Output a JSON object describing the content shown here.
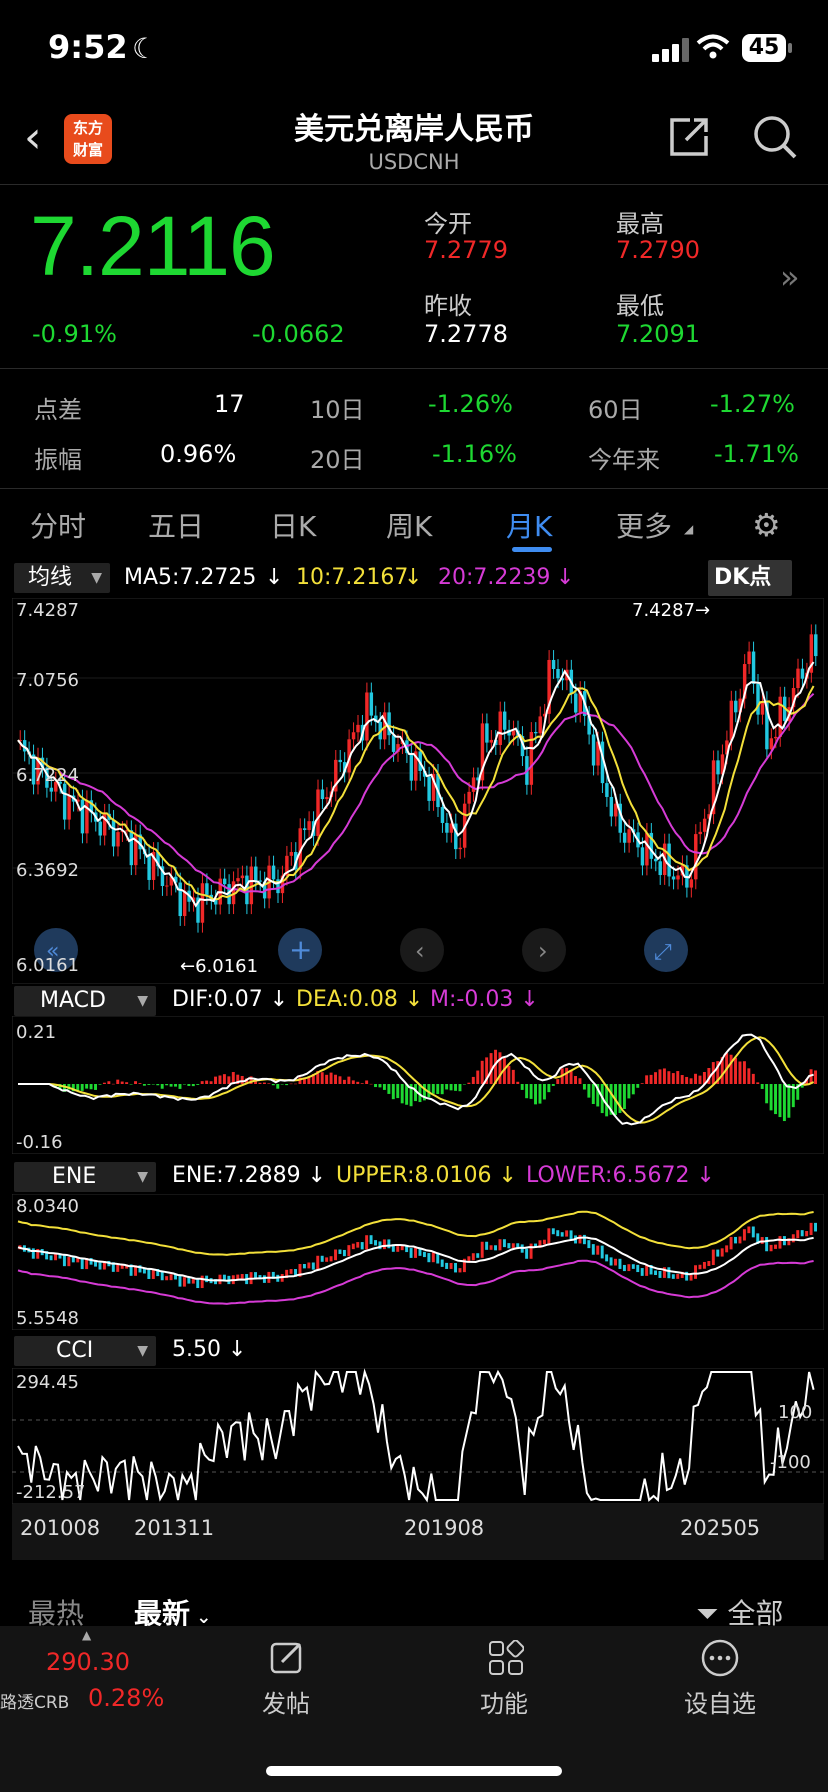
{
  "status_bar": {
    "time": "9:52",
    "battery": "45"
  },
  "header": {
    "logo_line1": "东方",
    "logo_line2": "财富",
    "title": "美元兑离岸人民币",
    "subtitle": "USDCNH"
  },
  "quote": {
    "price": "7.2116",
    "change_pct": "-0.91%",
    "change": "-0.0662",
    "open_label": "今开",
    "open": "7.2779",
    "high_label": "最高",
    "high": "7.2790",
    "prev_label": "昨收",
    "prev": "7.2778",
    "low_label": "最低",
    "low": "7.2091"
  },
  "stats": [
    {
      "label": "点差",
      "value": "17",
      "label2": "10日",
      "value2": "-1.26%",
      "label3": "60日",
      "value3": "-1.27%"
    },
    {
      "label": "振幅",
      "value": "0.96%",
      "label2": "20日",
      "value2": "-1.16%",
      "label3": "今年来",
      "value3": "-1.71%"
    }
  ],
  "tabs": [
    "分时",
    "五日",
    "日K",
    "周K",
    "月K",
    "更多"
  ],
  "active_tab": "月K",
  "chart": {
    "ma_selector": "均线",
    "ma5": "MA5:7.2725",
    "ma10": "10:7.2167",
    "ma20": "20:7.2239",
    "dk_button": "DK点",
    "y_labels": [
      "7.4287",
      "7.0756",
      "6.7224",
      "6.3692",
      "6.0161"
    ],
    "max_marker": "7.4287",
    "min_marker": "6.0161",
    "macd_selector": "MACD",
    "dif": "DIF:0.07",
    "dea": "DEA:0.08",
    "m": "M:-0.03",
    "macd_y": [
      "0.21",
      "-0.16"
    ],
    "ene_selector": "ENE",
    "ene": "ENE:7.2889",
    "upper": "UPPER:8.0106",
    "lower": "LOWER:6.5672",
    "ene_y": [
      "8.0340",
      "5.5548"
    ],
    "cci_selector": "CCI",
    "cci": "5.50",
    "cci_y": [
      "294.45",
      "-212.57"
    ],
    "cci_ref": [
      "100",
      "-100"
    ],
    "x_labels": [
      "201008",
      "201311",
      "201908",
      "202505"
    ],
    "colors": {
      "ma5": "#ffffff",
      "ma10": "#f3e03a",
      "ma20": "#d63bd6",
      "up": "#f02828",
      "down": "#22c8e0"
    }
  },
  "news": {
    "hot": "最热",
    "latest": "最新",
    "filter": "全部"
  },
  "ticker": {
    "value": "290.30",
    "name": "路透CRB",
    "pct": "0.28%"
  },
  "tabbar": [
    {
      "label": "发帖",
      "icon": "post-icon"
    },
    {
      "label": "功能",
      "icon": "grid-icon"
    },
    {
      "label": "设自选",
      "icon": "more-icon"
    }
  ]
}
